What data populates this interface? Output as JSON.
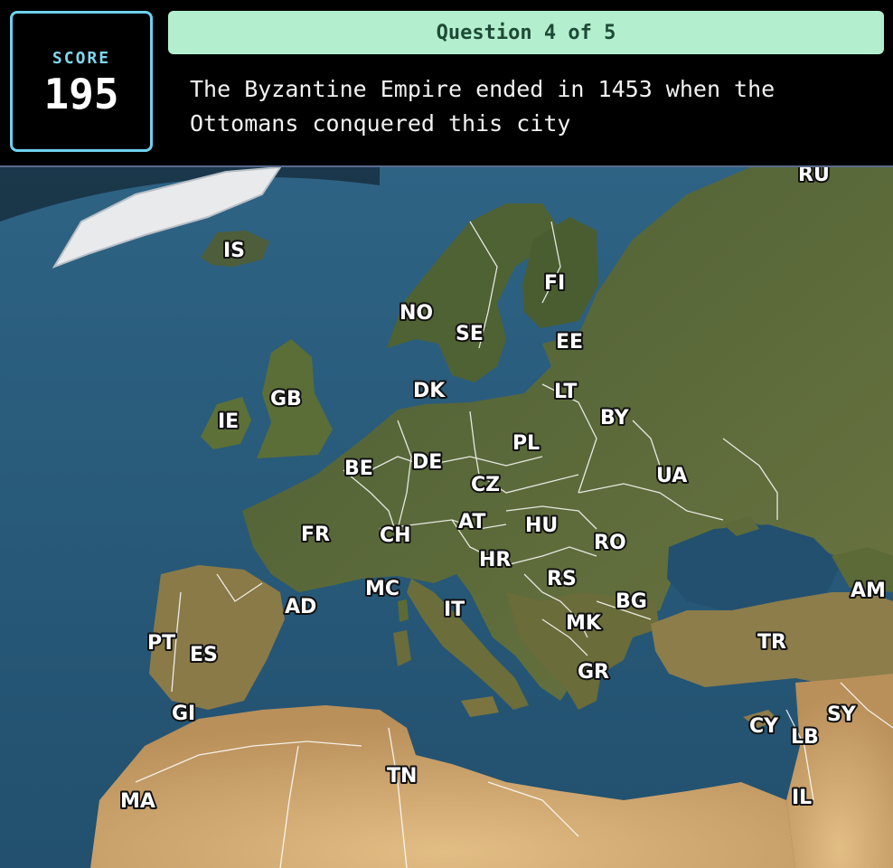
{
  "score": {
    "label": "SCORE",
    "value": "195"
  },
  "question": {
    "progress": "Question 4 of 5",
    "text": "The Byzantine Empire ended in 1453 when the Ottomans conquered this city"
  },
  "map": {
    "country_labels": [
      "RU",
      "IS",
      "FI",
      "NO",
      "SE",
      "EE",
      "DK",
      "LT",
      "GB",
      "BY",
      "IE",
      "PL",
      "BE",
      "DE",
      "UA",
      "CZ",
      "FR",
      "AT",
      "HU",
      "CH",
      "RO",
      "HR",
      "RS",
      "MC",
      "AM",
      "AD",
      "IT",
      "BG",
      "MK",
      "PT",
      "ES",
      "TR",
      "GR",
      "GI",
      "SY",
      "CY",
      "LB",
      "TN",
      "MA",
      "IL"
    ]
  },
  "colors": {
    "score_border": "#6fd0ee",
    "banner_bg": "#b3efce",
    "sea": "#2b5877",
    "land": "#56683a",
    "desert": "#cfa870"
  }
}
